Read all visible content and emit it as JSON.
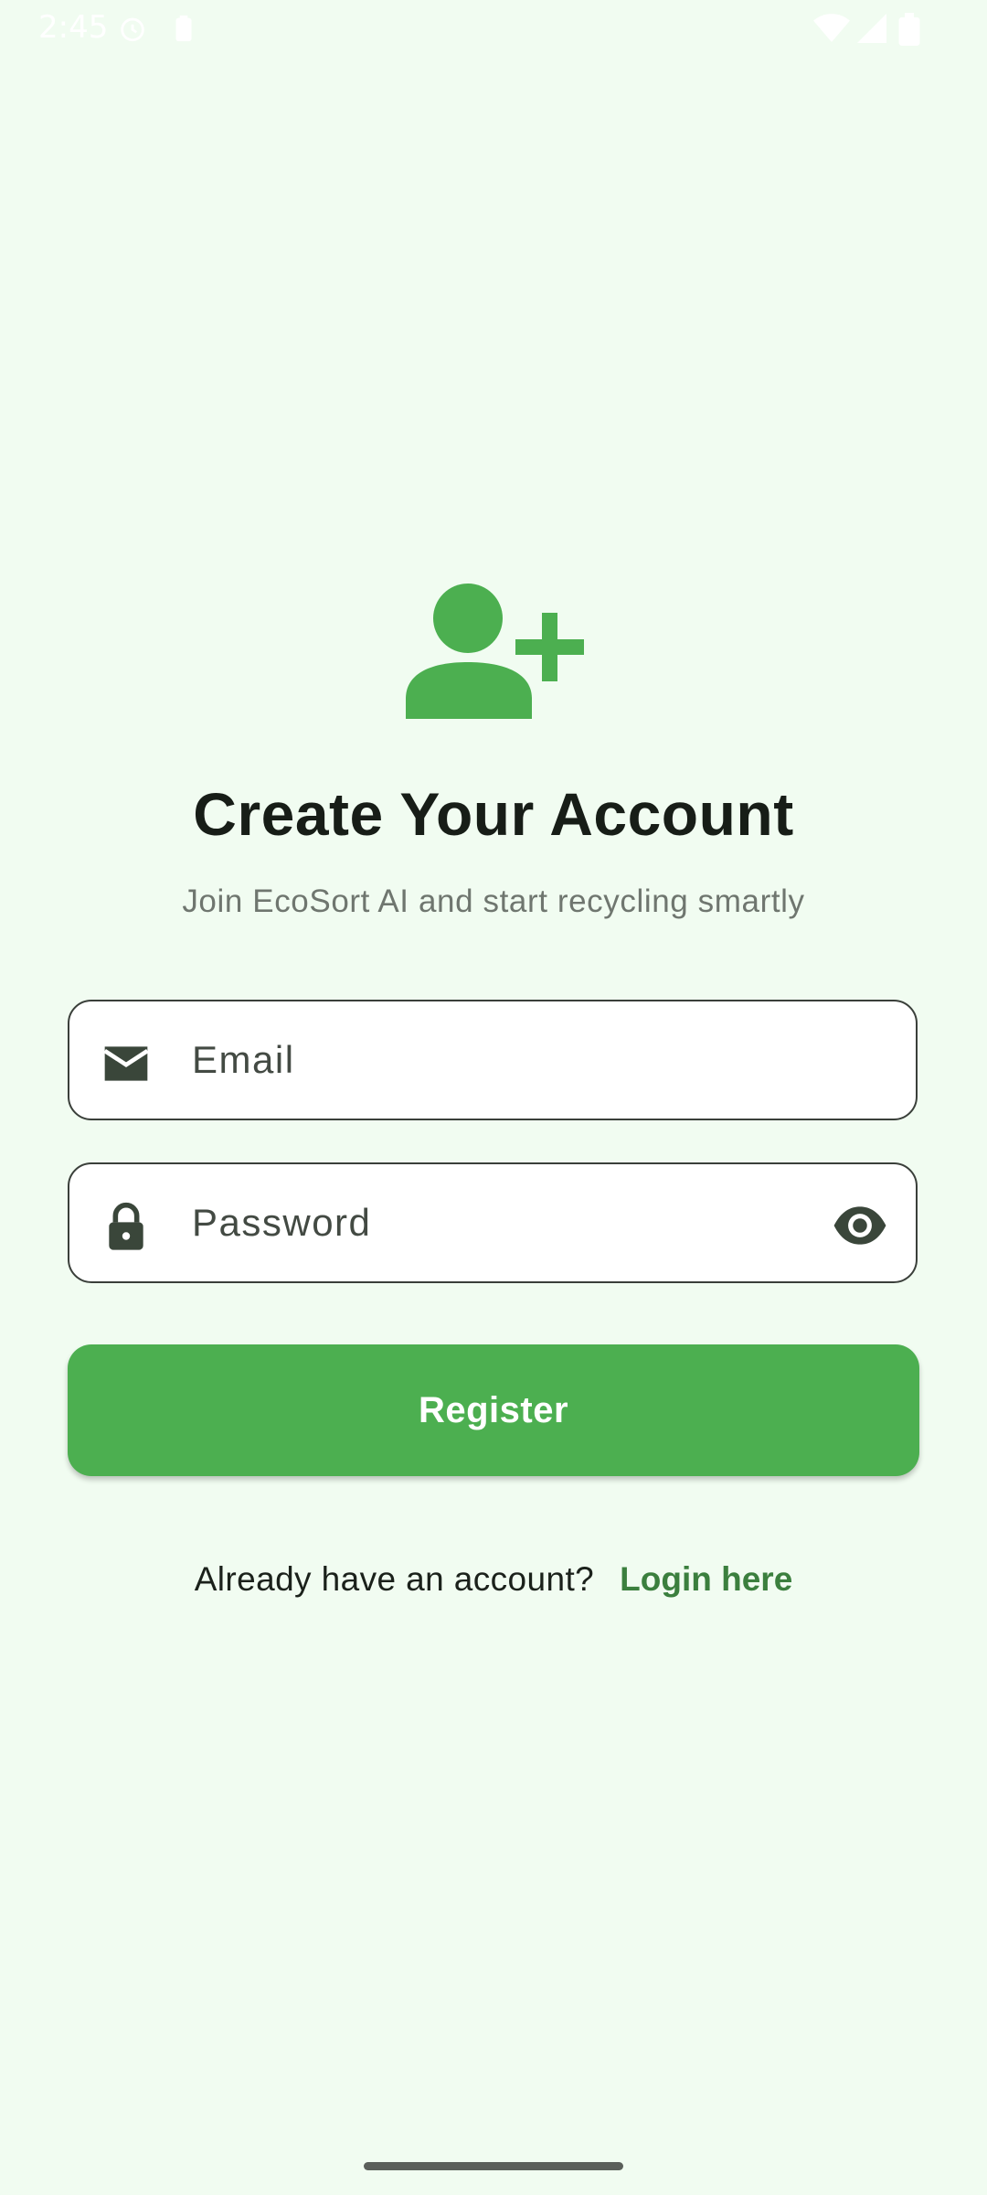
{
  "status_bar": {
    "time": "2:45",
    "icons": [
      "alarm-icon",
      "battery-saver-icon",
      "wifi-icon",
      "signal-icon",
      "battery-icon"
    ]
  },
  "colors": {
    "background": "#f1fcf1",
    "accent": "#4caf50",
    "link": "#3b7f3e",
    "icon_dark": "#3a463a"
  },
  "header": {
    "icon": "person-add-icon",
    "title": "Create Your Account",
    "subtitle": "Join EcoSort AI and start recycling smartly"
  },
  "form": {
    "email": {
      "icon": "mail-icon",
      "placeholder": "Email",
      "value": ""
    },
    "password": {
      "icon": "lock-icon",
      "placeholder": "Password",
      "value": "",
      "toggle_icon": "eye-icon"
    },
    "register_label": "Register"
  },
  "footer": {
    "prompt": "Already have an account?",
    "link_label": "Login here"
  }
}
